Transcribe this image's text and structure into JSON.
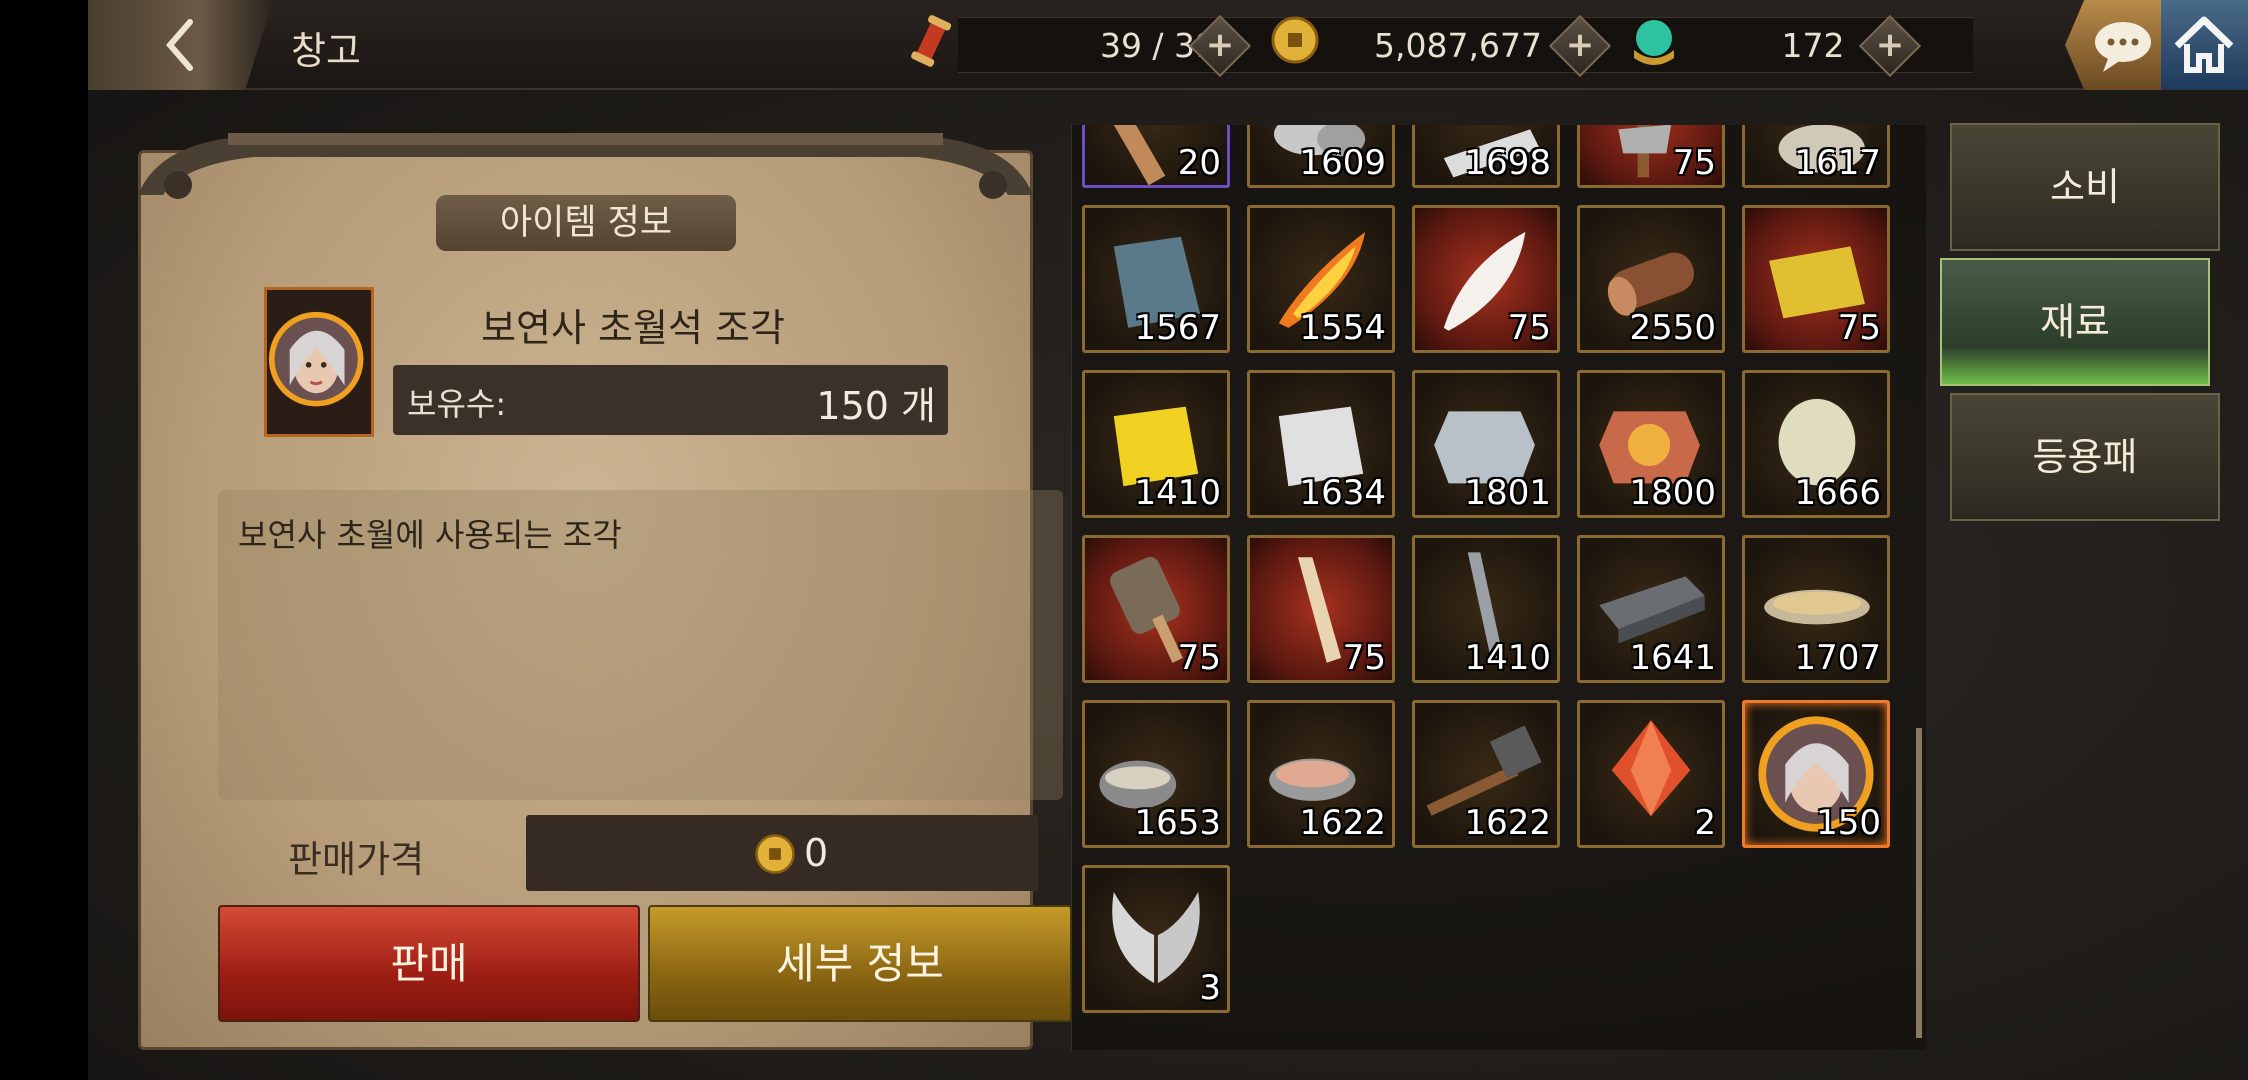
{
  "header": {
    "title": "창고",
    "resources": [
      {
        "icon": "scroll-icon",
        "value": "39 / 39"
      },
      {
        "icon": "gold-coin-icon",
        "value": "5,087,677"
      },
      {
        "icon": "jade-orb-icon",
        "value": "172"
      }
    ]
  },
  "info": {
    "section_title": "아이템 정보",
    "item_name": "보연사 초월석 조각",
    "owned_label": "보유수:",
    "owned_value": "150 개",
    "description": "보연사 초월에 사용되는 조각",
    "price_label": "판매가격",
    "price_value": "0",
    "sell_label": "판매",
    "detail_label": "세부 정보"
  },
  "grid": {
    "items": [
      {
        "icon": "wooden-staff-icon",
        "count": "20"
      },
      {
        "icon": "silver-ore-icon",
        "count": "1609"
      },
      {
        "icon": "silver-ingot-icon",
        "count": "1698"
      },
      {
        "icon": "battle-axe-icon",
        "count": "75"
      },
      {
        "icon": "fur-pelt-icon",
        "count": "1617"
      },
      {
        "icon": "blue-cloth-icon",
        "count": "1567"
      },
      {
        "icon": "flame-feather-icon",
        "count": "1554"
      },
      {
        "icon": "white-feather-icon",
        "count": "75"
      },
      {
        "icon": "log-icon",
        "count": "2550"
      },
      {
        "icon": "golden-silk-icon",
        "count": "75"
      },
      {
        "icon": "gold-cloth-icon",
        "count": "1410"
      },
      {
        "icon": "silver-cloth-icon",
        "count": "1634"
      },
      {
        "icon": "dragon-plate-icon",
        "count": "1801"
      },
      {
        "icon": "fire-dragon-plate-icon",
        "count": "1800"
      },
      {
        "icon": "jade-stone-icon",
        "count": "1666"
      },
      {
        "icon": "ornate-fan-icon",
        "count": "75"
      },
      {
        "icon": "bone-blade-icon",
        "count": "75"
      },
      {
        "icon": "steel-blade-icon",
        "count": "1410"
      },
      {
        "icon": "whetstone-icon",
        "count": "1641"
      },
      {
        "icon": "grain-bowl-icon",
        "count": "1707"
      },
      {
        "icon": "steaming-pot-icon",
        "count": "1653"
      },
      {
        "icon": "rice-bowl-icon",
        "count": "1622"
      },
      {
        "icon": "hammer-icon",
        "count": "1622"
      },
      {
        "icon": "red-crystal-icon",
        "count": "2"
      },
      {
        "icon": "portrait-fragment-icon",
        "count": "150"
      },
      {
        "icon": "silver-wings-icon",
        "count": "3"
      }
    ]
  },
  "categories": [
    {
      "label": "소비",
      "active": false
    },
    {
      "label": "재료",
      "active": true
    },
    {
      "label": "등용패",
      "active": false
    }
  ],
  "colors": {
    "selected_border": "#f07a28",
    "sell_button": "#b02a1c",
    "detail_button": "#a57d1c",
    "active_tab_glow": "#6ec04a"
  }
}
